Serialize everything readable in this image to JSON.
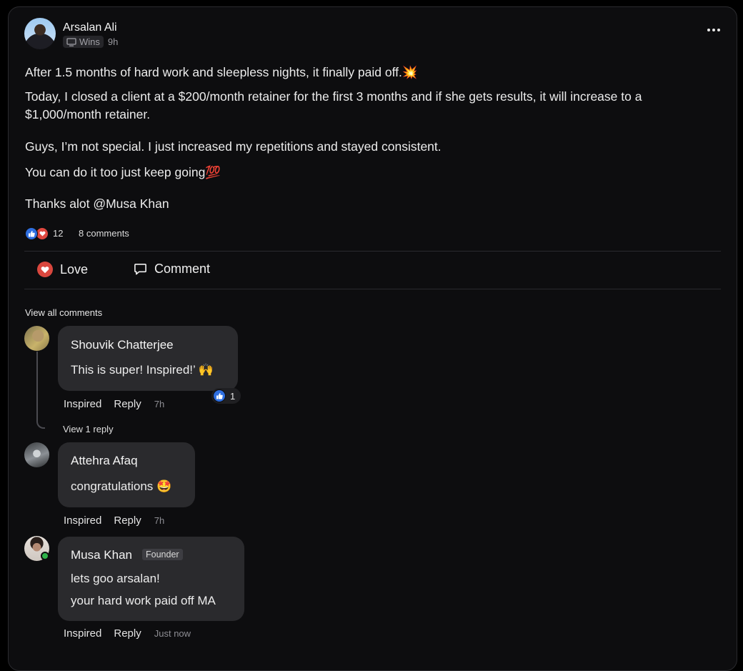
{
  "post": {
    "author": "Arsalan Ali",
    "category": "Wins",
    "time": "9h",
    "lines": [
      "After 1.5 months of hard work and sleepless nights, it finally paid off.💥",
      "Today, I closed a client at a $200/month retainer for the first 3 months and if she gets results, it will increase to a",
      "$1,000/month retainer.",
      "Guys, I’m not special. I just increased my repetitions and stayed consistent.",
      "You can do it too just keep going💯",
      "Thanks alot @Musa Khan"
    ],
    "reaction_count": "12",
    "comments_count": "8 comments"
  },
  "actions": {
    "love": "Love",
    "comment": "Comment"
  },
  "view_all_comments": "View all comments",
  "comments": [
    {
      "name": "Shouvik Chatterjee",
      "lines": [
        "This is super! Inspired!’ 🙌"
      ],
      "reaction_count": "1",
      "inspired": "Inspired",
      "reply": "Reply",
      "time": "7h",
      "view_replies": "View 1 reply"
    },
    {
      "name": "Attehra Afaq",
      "lines": [
        "congratulations 🤩"
      ],
      "inspired": "Inspired",
      "reply": "Reply",
      "time": "7h"
    },
    {
      "name": "Musa Khan",
      "badge": "Founder",
      "lines": [
        "lets goo arsalan!",
        "your hard work paid off MA"
      ],
      "inspired": "Inspired",
      "reply": "Reply",
      "time": "Just now"
    }
  ],
  "colors": {
    "background": "#0d0d0f",
    "bubble": "#2a2a2d",
    "like_blue": "#2f6fe0",
    "love_red": "#d9473e",
    "online_green": "#2fb34a"
  }
}
